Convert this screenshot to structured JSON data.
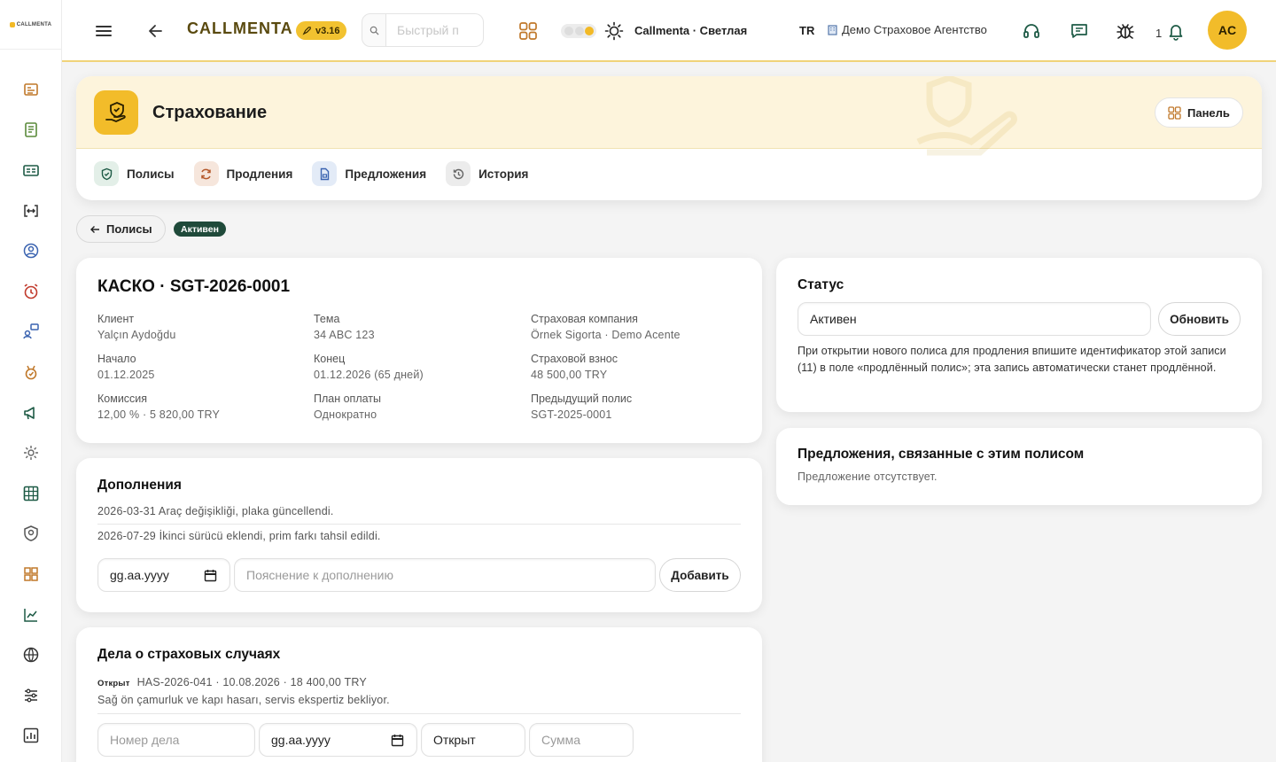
{
  "app": {
    "logo_text": "CALLMENTA",
    "brand": "CALLMENTA",
    "version": "v3.16",
    "search_placeholder": "Быстрый п",
    "theme_label": "Callmenta · Светлая",
    "language": "TR",
    "agency": "Демо Страховое Агентство",
    "notifications_count": "1",
    "user_initials": "AC",
    "accent_color": "#f2bc2a"
  },
  "sidebar": {
    "icons": [
      "dashboard-icon",
      "clipboard-icon",
      "id-card-icon",
      "code-brackets-icon",
      "user-circle-icon",
      "alarm-icon",
      "user-chat-icon",
      "medal-icon",
      "megaphone-icon",
      "settings-icon",
      "grid-icon",
      "shield-icon",
      "boxes-icon",
      "chart-line-icon",
      "globe-icon",
      "sliders-icon",
      "report-icon",
      "warning-icon"
    ]
  },
  "module": {
    "title": "Страхование",
    "panel_button": "Панель",
    "tabs": [
      {
        "label": "Полисы",
        "icon": "shield-check-icon",
        "bg": "#e3efe8"
      },
      {
        "label": "Продления",
        "icon": "refresh-icon",
        "bg": "#f6e6dc"
      },
      {
        "label": "Предложения",
        "icon": "document-icon",
        "bg": "#e3ebf7"
      },
      {
        "label": "История",
        "icon": "history-icon",
        "bg": "#ececec"
      }
    ]
  },
  "breadcrumb": {
    "back_label": "Полисы",
    "status": "Активен"
  },
  "policy": {
    "title": "КАСКО · SGT-2026-0001",
    "fields": [
      {
        "label": "Клиент",
        "value": "Yalçın Aydoğdu"
      },
      {
        "label": "Тема",
        "value": "34 ABC 123"
      },
      {
        "label": "Страховая компания",
        "value": "Örnek Sigorta · Demo Acente"
      },
      {
        "label": "Начало",
        "value": "01.12.2025"
      },
      {
        "label": "Конец",
        "value": "01.12.2026 (65 дней)"
      },
      {
        "label": "Страховой взнос",
        "value": "48 500,00 TRY"
      },
      {
        "label": "Комиссия",
        "value": "12,00 % · 5 820,00 TRY"
      },
      {
        "label": "План оплаты",
        "value": "Однократно"
      },
      {
        "label": "Предыдущий полис",
        "value": "SGT-2025-0001"
      }
    ]
  },
  "addenda": {
    "title": "Дополнения",
    "items": [
      "2026-03-31 Araç değişikliği, plaka güncellendi.",
      "2026-07-29 İkinci sürücü eklendi, prim farkı tahsil edildi."
    ],
    "date_placeholder": "gg.aa.yyyy",
    "note_placeholder": "Пояснение к дополнению",
    "add_button": "Добавить"
  },
  "claims": {
    "title": "Дела о страховых случаях",
    "items": [
      {
        "status": "Открыт",
        "line": "HAS-2026-041 · 10.08.2026 · 18 400,00 TRY",
        "description": "Sağ ön çamurluk ve kapı hasarı, servis ekspertiz bekliyor."
      }
    ],
    "case_placeholder": "Номер дела",
    "date_placeholder": "gg.aa.yyyy",
    "status_value": "Открыт",
    "amount_placeholder": "Сумма"
  },
  "status_card": {
    "title": "Статус",
    "value": "Активен",
    "update_button": "Обновить",
    "note": "При открытии нового полиса для продления впишите идентификатор этой записи (11) в поле «продлённый полис»; эта запись автоматически станет продлённой."
  },
  "offers_card": {
    "title": "Предложения, связанные с этим полисом",
    "empty": "Предложение отсутствует."
  }
}
